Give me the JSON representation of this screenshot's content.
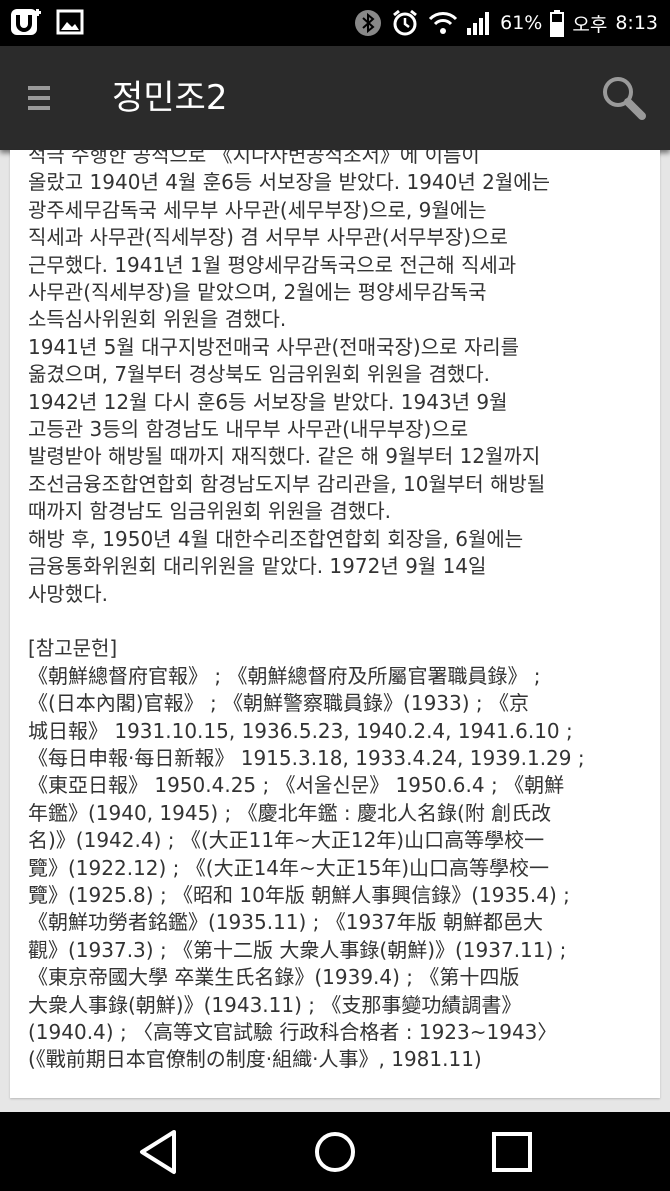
{
  "status_bar": {
    "battery": "61%",
    "ampm": "오후",
    "time": "8:13"
  },
  "app_bar": {
    "title": "정민조2"
  },
  "article": {
    "body": "적극 수행한 공적으로 《지나사변공적조서》에 이름이\n올랐고 1940년 4월 훈6등 서보장을 받았다. 1940년 2월에는\n광주세무감독국 세무부 사무관(세무부장)으로, 9월에는\n직세과 사무관(직세부장) 겸 서무부 사무관(서무부장)으로\n근무했다. 1941년 1월 평양세무감독국으로 전근해 직세과\n사무관(직세부장)을 맡았으며, 2월에는 평양세무감독국\n소득심사위원회 위원을 겸했다.\n1941년 5월 대구지방전매국 사무관(전매국장)으로 자리를\n옮겼으며, 7월부터 경상북도 임금위원회 위원을 겸했다.\n1942년 12월 다시 훈6등 서보장을 받았다. 1943년 9월\n고등관 3등의 함경남도 내무부 사무관(내무부장)으로\n발령받아 해방될 때까지 재직했다. 같은 해 9월부터 12월까지\n조선금융조합연합회 함경남도지부 감리관을, 10월부터 해방될\n때까지 함경남도 임금위원회 위원을 겸했다.\n해방 후, 1950년 4월 대한수리조합연합회 회장을, 6월에는\n금융통화위원회 대리위원을 맡았다. 1972년 9월 14일\n사망했다.",
    "references_heading": "[참고문헌]",
    "references": "《朝鮮總督府官報》 ; 《朝鮮總督府及所屬官署職員錄》 ;\n《(日本內閣)官報》 ; 《朝鮮警察職員錄》(1933) ; 《京\n城日報》 1931.10.15, 1936.5.23, 1940.2.4, 1941.6.10 ;\n《每日申報·每日新報》 1915.3.18, 1933.4.24, 1939.1.29 ;\n《東亞日報》 1950.4.25 ; 《서울신문》 1950.6.4 ; 《朝鮮\n年鑑》(1940, 1945) ; 《慶北年鑑 : 慶北人名錄(附 創氏改\n名)》(1942.4) ; 《(大正11年~大正12年)山口高等學校一\n覽》(1922.12) ; 《(大正14年~大正15年)山口高等學校一\n覽》(1925.8) ; 《昭和 10年版 朝鮮人事興信錄》(1935.4) ;\n《朝鮮功勞者銘鑑》(1935.11) ; 《1937年版 朝鮮都邑大\n觀》(1937.3) ; 《第十二版 大衆人事錄(朝鮮)》(1937.11) ;\n《東京帝國大學 卒業生氏名錄》(1939.4) ; 《第十四版\n大衆人事錄(朝鮮)》(1943.11) ; 《支那事變功績調書》\n(1940.4) ; 〈高等文官試驗 行政科合格者 : 1923~1943〉\n(《戰前期日本官僚制の制度·組織·人事》, 1981.11)"
  },
  "icons": {
    "menu": "hamburger-menu-icon",
    "search": "search-icon",
    "back": "back-triangle-icon",
    "home": "home-circle-icon",
    "recents": "recents-square-icon"
  }
}
